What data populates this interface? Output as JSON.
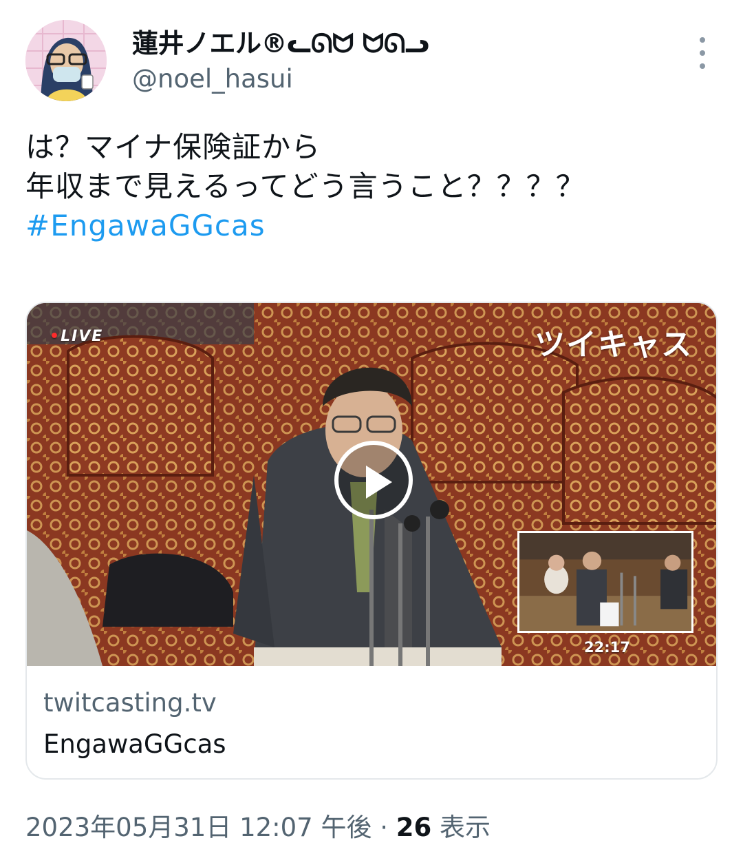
{
  "user": {
    "display_name": "蓮井ノエル®ᓚᘏᗢ ᗢᘏᓗ",
    "handle": "@noel_hasui",
    "avatar_icon": "avatar-illustration"
  },
  "tweet": {
    "lines": [
      "は？マイナ保険証から",
      "年収まで見えるってどう言うこと？？？？"
    ],
    "hashtag": "#EngawaGGcas"
  },
  "card": {
    "live_label": "LIVE",
    "logo_text": "ツイキャス",
    "timestamp_overlay": "22:17",
    "domain": "twitcasting.tv",
    "title": "EngawaGGcas"
  },
  "meta": {
    "datetime": "2023年05月31日 12:07 午後",
    "separator": " · ",
    "views": "26",
    "views_label": " 表示"
  },
  "colors": {
    "link": "#1d9bf0",
    "secondary": "#536471",
    "text": "#0f1419"
  }
}
